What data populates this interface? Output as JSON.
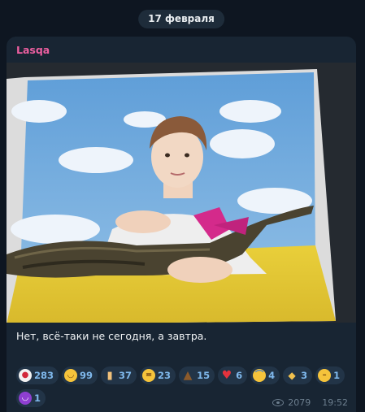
{
  "date_separator": "17 февраля",
  "message": {
    "sender": "Lasqa",
    "sender_color": "#ec5fa0",
    "photo_description_icon": "photo",
    "text": "Нет, всё-таки не сегодня, а завтра.",
    "views": "2079",
    "time": "19:52"
  },
  "reactions": [
    {
      "icon": "clown-face",
      "glyph": "🤡",
      "bg": "#f2f2f2",
      "count": "283"
    },
    {
      "icon": "rofl-face",
      "glyph": "🤣",
      "bg": "#f5c33b",
      "count": "99"
    },
    {
      "icon": "middle-finger",
      "glyph": "🖕",
      "bg": "#223447",
      "count": "37"
    },
    {
      "icon": "grinning-squint-face",
      "glyph": "😆",
      "bg": "#f5c33b",
      "count": "23"
    },
    {
      "icon": "pile-of-poo",
      "glyph": "💩",
      "bg": "#223447",
      "count": "15"
    },
    {
      "icon": "red-heart",
      "glyph": "❤",
      "bg": "#223447",
      "count": "6"
    },
    {
      "icon": "crying-face",
      "glyph": "😢",
      "bg": "#f5c33b",
      "count": "4"
    },
    {
      "icon": "handshake",
      "glyph": "🤝",
      "bg": "#223447",
      "count": "3"
    },
    {
      "icon": "neutral-face",
      "glyph": "😐",
      "bg": "#f5c33b",
      "count": "1"
    },
    {
      "icon": "smiling-devil",
      "glyph": "😈",
      "bg": "#8e3fd1",
      "count": "1"
    }
  ]
}
